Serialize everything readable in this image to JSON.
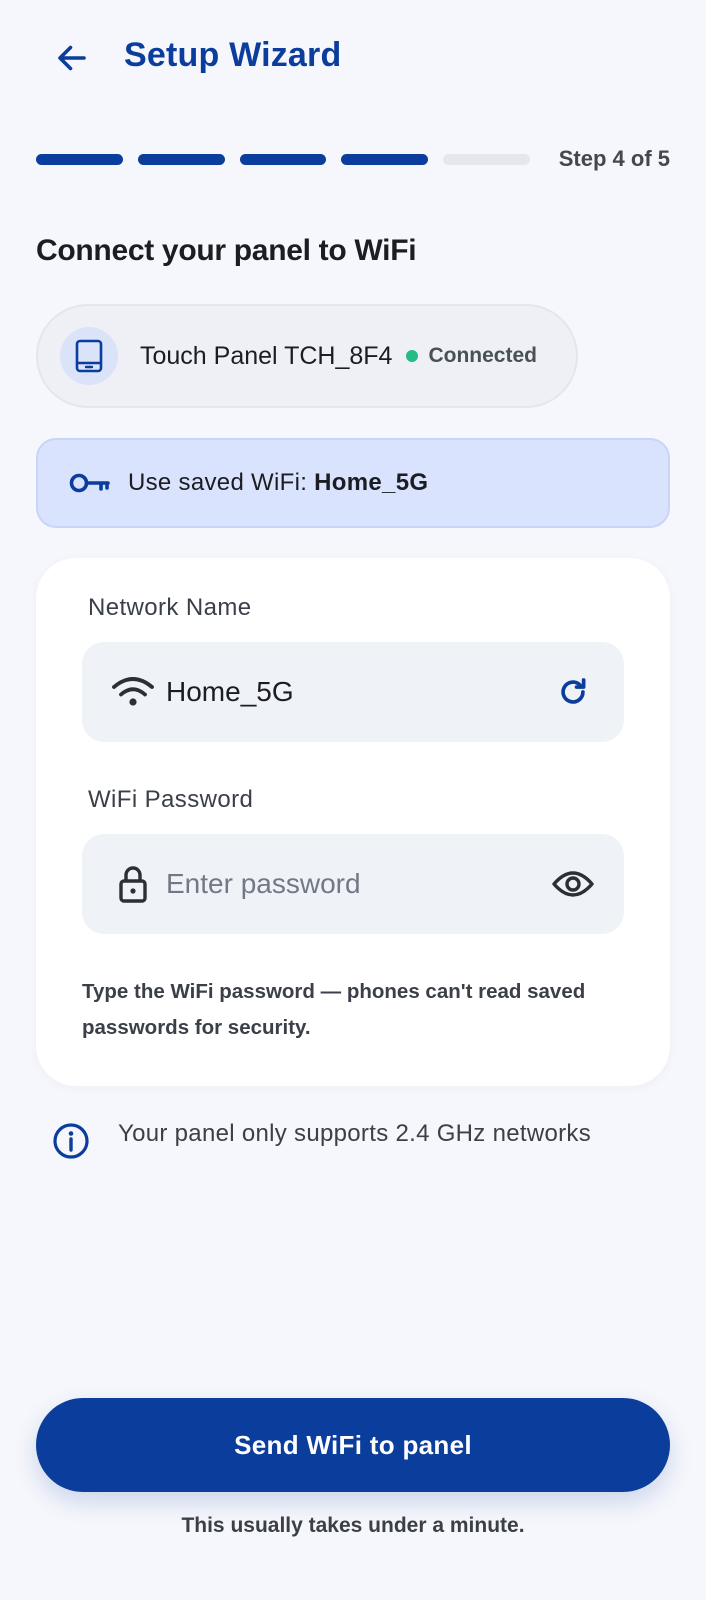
{
  "header": {
    "title": "Setup Wizard",
    "back_icon": "arrow-left-icon"
  },
  "progress": {
    "total_steps": 5,
    "completed_steps": 4,
    "label": "Step 4 of 5"
  },
  "heading": "Connect your panel to WiFi",
  "device": {
    "icon": "tablet-icon",
    "name": "Touch Panel TCH_8F4",
    "status": "Connected",
    "status_color": "#24bb86"
  },
  "saved_wifi": {
    "icon": "key-icon",
    "prefix": "Use saved WiFi: ",
    "network": "Home_5G"
  },
  "form": {
    "network_label": "Network Name",
    "network_value": "Home_5G",
    "network_icon": "wifi-icon",
    "refresh_icon": "refresh-icon",
    "password_label": "WiFi Password",
    "password_placeholder": "Enter password",
    "password_value": "",
    "lock_icon": "lock-icon",
    "eye_icon": "eye-icon",
    "hint": "Type the WiFi password — phones can't read saved passwords for security."
  },
  "info": {
    "icon": "info-icon",
    "text": "Your panel only supports 2.4 GHz networks"
  },
  "actions": {
    "send_label": "Send WiFi to panel",
    "footnote": "This usually takes under a minute."
  },
  "colors": {
    "primary": "#0b3d9c",
    "background": "#f6f7fc",
    "saved_wifi_bg": "#dae3fd",
    "field_bg": "#eff2f7"
  }
}
